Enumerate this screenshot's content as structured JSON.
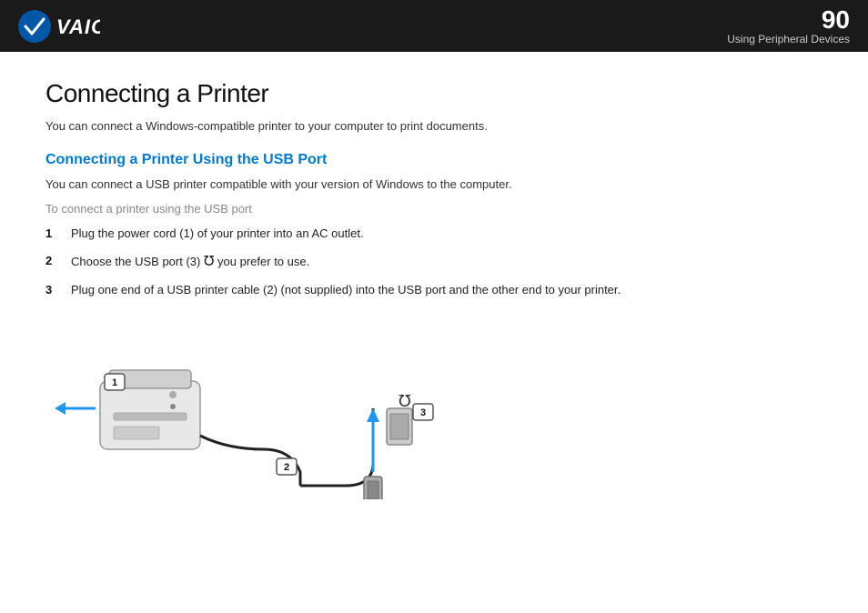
{
  "header": {
    "page_number": "90",
    "section_label": "Using Peripheral Devices",
    "logo_text": "VAIO"
  },
  "main": {
    "title": "Connecting a Printer",
    "intro": "You can connect a Windows-compatible printer to your computer to print documents.",
    "section_title": "Connecting a Printer Using the USB Port",
    "section_intro": "You can connect a USB printer compatible with your version of Windows to the computer.",
    "procedure_title": "To connect a printer using the USB port",
    "steps": [
      {
        "num": "1",
        "text": "Plug the power cord (1) of your printer into an AC outlet."
      },
      {
        "num": "2",
        "text": "Choose the USB port (3)   you prefer to use."
      },
      {
        "num": "3",
        "text": "Plug one end of a USB printer cable (2) (not supplied) into the USB port and the other end to your printer."
      }
    ]
  }
}
